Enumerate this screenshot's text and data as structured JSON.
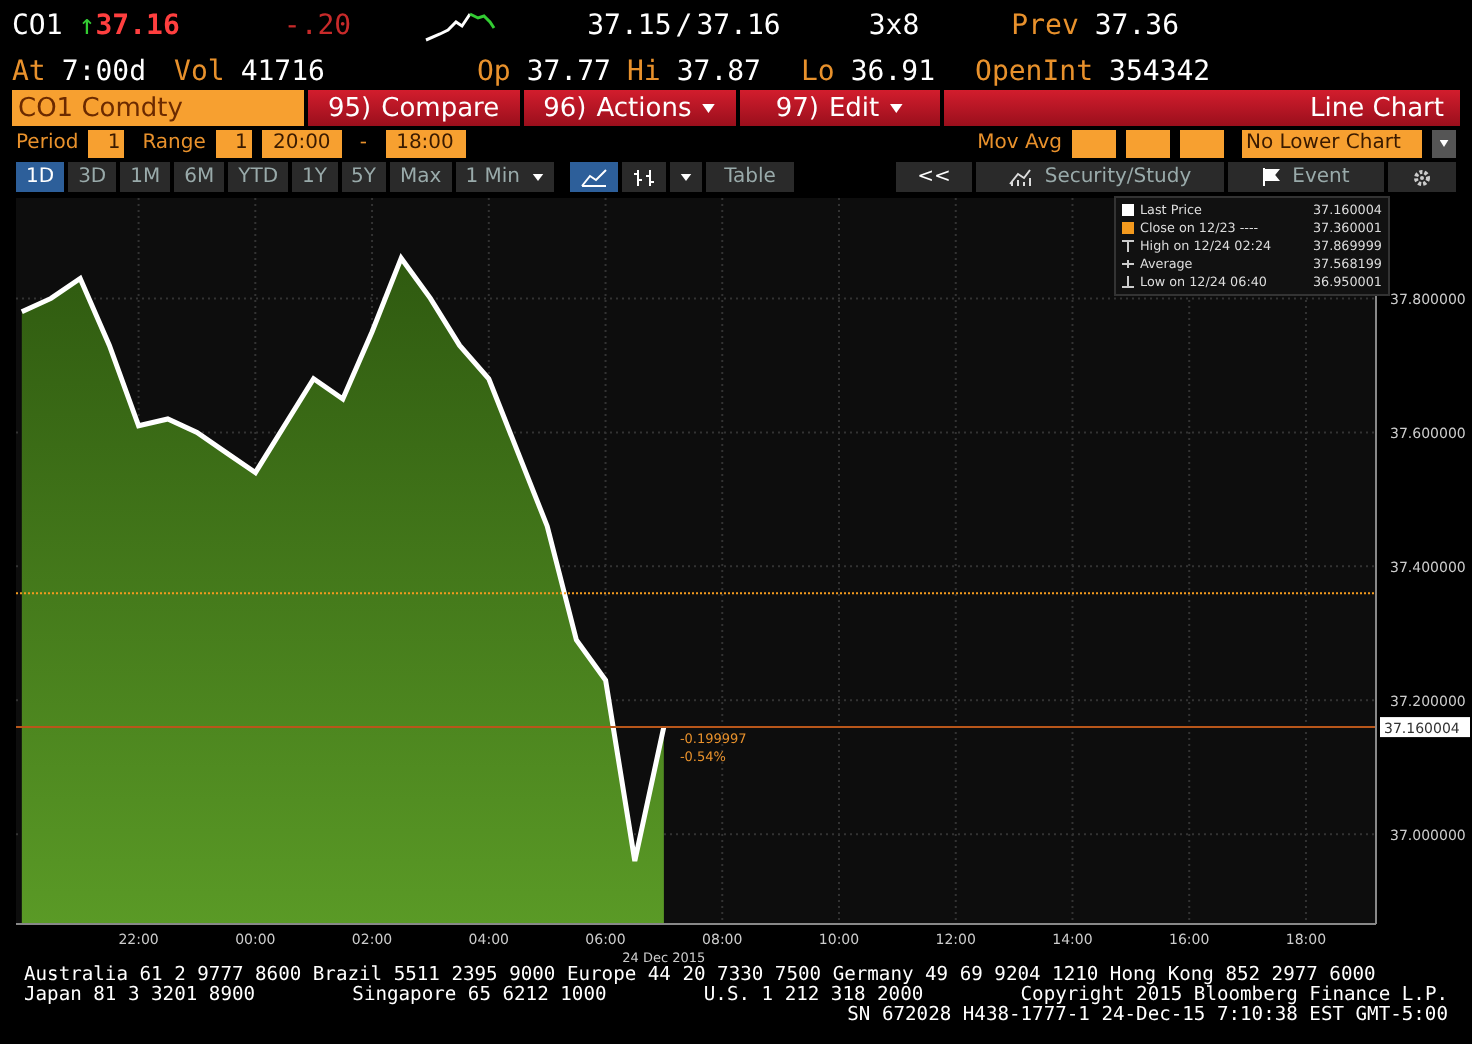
{
  "quote": {
    "ticker": "CO1",
    "arrow": "↑",
    "last": "37.16",
    "change": "-.20",
    "bid": "37.15",
    "separator": "/",
    "ask": "37.16",
    "size": "3x8",
    "prev_label": "Prev",
    "prev": "37.36"
  },
  "quote_fields": [
    {
      "label": "At",
      "value": "7:00d"
    },
    {
      "label": "Vol",
      "value": "41716"
    },
    {
      "label": "Op",
      "value": "37.77"
    },
    {
      "label": "Hi",
      "value": "37.87"
    },
    {
      "label": "Lo",
      "value": "36.91"
    },
    {
      "label": "OpenInt",
      "value": "354342"
    }
  ],
  "command_bar": {
    "security": "CO1 Comdty",
    "menus": [
      {
        "number": "95)",
        "label": "Compare",
        "dropdown": false
      },
      {
        "number": "96)",
        "label": "Actions",
        "dropdown": true
      },
      {
        "number": "97)",
        "label": "Edit",
        "dropdown": true
      }
    ],
    "title": "Line Chart"
  },
  "settings": {
    "period_label": "Period",
    "period": "1",
    "range_label": "Range",
    "range": "1",
    "start": "20:00",
    "dash": "-",
    "end": "18:00",
    "mov_avg_label": "Mov Avg",
    "lower_chart": "No Lower Chart"
  },
  "toolbar": {
    "ranges": [
      {
        "label": "1D",
        "selected": true
      },
      {
        "label": "3D",
        "selected": false
      },
      {
        "label": "1M",
        "selected": false
      },
      {
        "label": "6M",
        "selected": false
      },
      {
        "label": "YTD",
        "selected": false
      },
      {
        "label": "1Y",
        "selected": false
      },
      {
        "label": "5Y",
        "selected": false
      },
      {
        "label": "Max",
        "selected": false
      }
    ],
    "interval": "1 Min",
    "chart_types": [
      {
        "kind": "line",
        "selected": true
      },
      {
        "kind": "bars",
        "selected": false
      }
    ],
    "table": "Table",
    "collapse": "<<",
    "study": "Security/Study",
    "event": "Event"
  },
  "legend": [
    {
      "kind": "swatch",
      "color": "#ffffff",
      "label": "Last Price",
      "value": "37.160004"
    },
    {
      "kind": "swatch",
      "color": "#f39a1e",
      "label": "Close on 12/23 ----",
      "value": "37.360001"
    },
    {
      "kind": "high",
      "label": "High on 12/24 02:24",
      "value": "37.869999"
    },
    {
      "kind": "average",
      "label": "Average",
      "value": "37.568199"
    },
    {
      "kind": "low",
      "label": "Low on 12/24 06:40",
      "value": "36.950001"
    }
  ],
  "chart_data": {
    "type": "area",
    "categories": [
      null,
      null,
      null,
      null,
      "22:00",
      null,
      null,
      null,
      "00:00",
      null,
      null,
      null,
      "02:00",
      null,
      null,
      null,
      "04:00",
      null,
      null,
      null,
      "06:00",
      null,
      null,
      null,
      "08:00",
      null,
      null,
      null,
      "10:00",
      null,
      null,
      null,
      "12:00",
      null,
      null,
      null,
      "14:00",
      null,
      null,
      null,
      "16:00",
      null,
      null,
      null,
      "18:00",
      null
    ],
    "series": [
      {
        "color": "#ffffff",
        "values": [
          37.78,
          37.8,
          37.83,
          37.73,
          37.61,
          37.62,
          37.6,
          37.57,
          37.54,
          37.61,
          37.68,
          37.65,
          37.75,
          37.86,
          37.8,
          37.73,
          37.68,
          37.57,
          37.46,
          37.29,
          37.23,
          36.96,
          37.16,
          null,
          null,
          null,
          null,
          null,
          null,
          null,
          null,
          null,
          null,
          null,
          null,
          null,
          null,
          null,
          null,
          null,
          null,
          null,
          null,
          null,
          null,
          null
        ]
      }
    ],
    "ylim": [
      36.866,
      37.95
    ],
    "grid": true,
    "ref_lines": [
      {
        "axis": "y",
        "value": 37.36,
        "color": "#f39a1e"
      },
      {
        "axis": "y",
        "value": 37.16,
        "color": "#b8561a"
      }
    ],
    "yticks": [
      {
        "value": 37.0,
        "label": "37.000000"
      },
      {
        "value": 37.2,
        "label": "37.200000"
      },
      {
        "value": 37.4,
        "label": "37.400000"
      },
      {
        "value": 37.6,
        "label": "37.600000"
      },
      {
        "value": 37.8,
        "label": "37.800000"
      }
    ],
    "xlabel": "24 Dec 2015"
  },
  "chart_overlay": {
    "last_price": "37.160004",
    "change": "-0.199997",
    "change_pct": "-0.54%"
  },
  "footer": [
    [
      "Australia 61 2 9777 8600 Brazil 5511 2395 9000 Europe 44 20 7330 7500 Germany 49 69 9204 1210 Hong Kong 852 2977 6000"
    ],
    [
      "Japan 81 3 3201 8900",
      "Singapore 65 6212 1000",
      "U.S. 1 212 318 2000",
      "Copyright 2015 Bloomberg Finance L.P."
    ],
    [
      "SN 672028 H438-1777-1 24-Dec-15  7:10:38 EST  GMT-5:00"
    ]
  ]
}
